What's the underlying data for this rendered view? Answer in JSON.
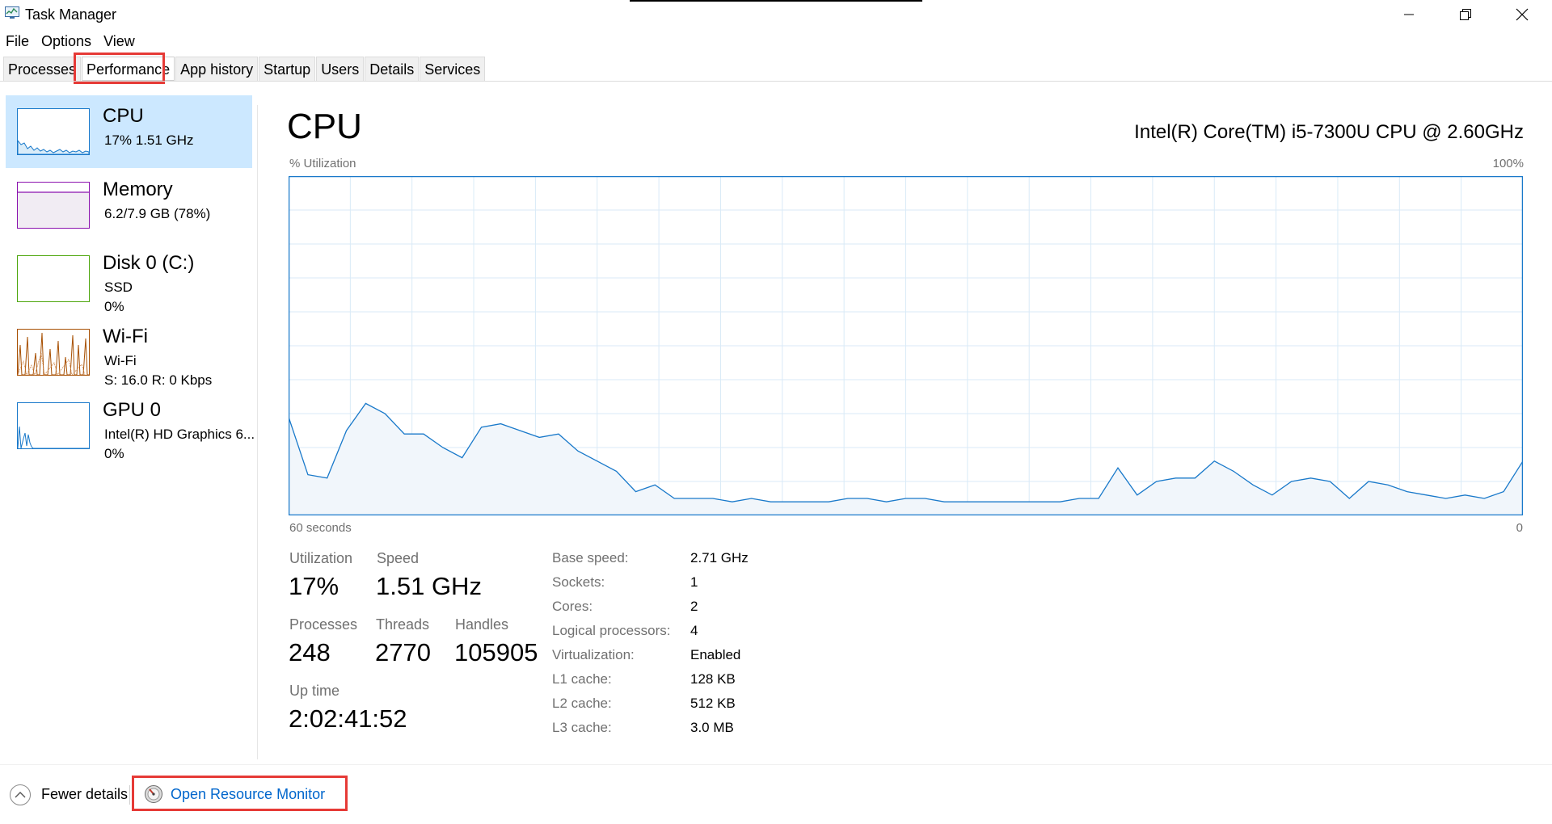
{
  "window": {
    "title": "Task Manager"
  },
  "menu": [
    "File",
    "Options",
    "View"
  ],
  "tabs": [
    "Processes",
    "Performance",
    "App history",
    "Startup",
    "Users",
    "Details",
    "Services"
  ],
  "active_tab": "Performance",
  "sidebar": [
    {
      "name": "CPU",
      "line1": "17%  1.51 GHz"
    },
    {
      "name": "Memory",
      "line1": "6.2/7.9 GB (78%)"
    },
    {
      "name": "Disk 0 (C:)",
      "line1": "SSD",
      "line2": "0%"
    },
    {
      "name": "Wi-Fi",
      "line1": "Wi-Fi",
      "line2": "S: 16.0  R: 0 Kbps"
    },
    {
      "name": "GPU 0",
      "line1": "Intel(R) HD Graphics 6...",
      "line2": "0%"
    }
  ],
  "main": {
    "title": "CPU",
    "model": "Intel(R) Core(TM) i5-7300U CPU @ 2.60GHz",
    "y_label": "% Utilization",
    "y_max": "100%",
    "x_left": "60 seconds",
    "x_right": "0"
  },
  "stats": {
    "utilization_label": "Utilization",
    "utilization": "17%",
    "speed_label": "Speed",
    "speed": "1.51 GHz",
    "processes_label": "Processes",
    "processes": "248",
    "threads_label": "Threads",
    "threads": "2770",
    "handles_label": "Handles",
    "handles": "105905",
    "uptime_label": "Up time",
    "uptime": "2:02:41:52"
  },
  "info": [
    {
      "label": "Base speed:",
      "value": "2.71 GHz"
    },
    {
      "label": "Sockets:",
      "value": "1"
    },
    {
      "label": "Cores:",
      "value": "2"
    },
    {
      "label": "Logical processors:",
      "value": "4"
    },
    {
      "label": "Virtualization:",
      "value": "Enabled"
    },
    {
      "label": "L1 cache:",
      "value": "128 KB"
    },
    {
      "label": "L2 cache:",
      "value": "512 KB"
    },
    {
      "label": "L3 cache:",
      "value": "3.0 MB"
    }
  ],
  "footer": {
    "fewer": "Fewer details",
    "resmon": "Open Resource Monitor"
  },
  "colors": {
    "cpu": "#1979ca",
    "memory": "#8b12ae",
    "disk": "#4da60c",
    "wifi": "#a74f01",
    "gpu": "#1979ca",
    "highlight": "#e63a36",
    "link": "#0066cc",
    "selected": "#cce8ff"
  },
  "chart_data": {
    "type": "area",
    "ylabel": "% Utilization",
    "ylim": [
      0,
      100
    ],
    "x": [
      60,
      58.3,
      56.6,
      54.8,
      53.1,
      51.4,
      49.7,
      48,
      46.3,
      44.5,
      42.8,
      41.1,
      39.4,
      37.7,
      36,
      34.2,
      32.5,
      30.8,
      29.1,
      27.4,
      25.7,
      24,
      22.2,
      20.5,
      18.8,
      17.1,
      15.4,
      13.7,
      12,
      10.3,
      8.6,
      6.9,
      5.1,
      3.4,
      1.7,
      0
    ],
    "xlim": [
      60,
      0
    ],
    "values": [
      29,
      12,
      11,
      25,
      33,
      30,
      24,
      24,
      20,
      17,
      26,
      27,
      25,
      23,
      24,
      19,
      16,
      13,
      7,
      9,
      5,
      5,
      5,
      4,
      5,
      4,
      4,
      4,
      4,
      5,
      5,
      4,
      5,
      5,
      4,
      4,
      4,
      4,
      4,
      4,
      4,
      5,
      5,
      14,
      6,
      10,
      11,
      11,
      16,
      13,
      9,
      6,
      10,
      11,
      10,
      5,
      10,
      9,
      7,
      6,
      5,
      6,
      5,
      7,
      16
    ]
  }
}
